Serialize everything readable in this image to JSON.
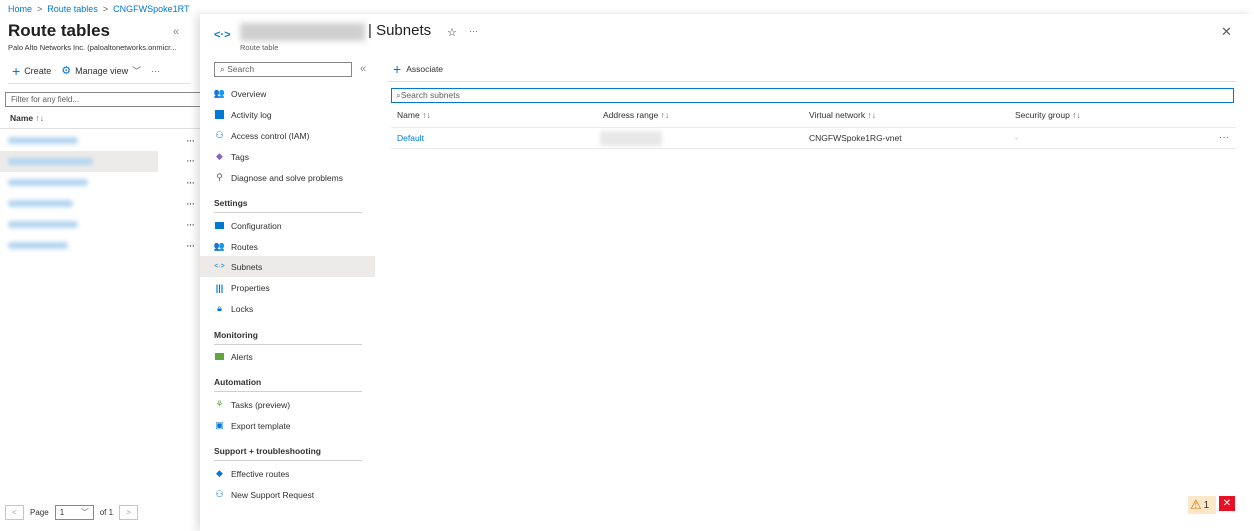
{
  "breadcrumb": [
    "Home",
    "Route tables",
    "CNGFWSpoke1RT"
  ],
  "left": {
    "title": "Route tables",
    "subtitle": "Palo Alto Networks Inc. (paloaltonetworks.onmicr...",
    "create_label": "Create",
    "manage_view_label": "Manage view",
    "filter_placeholder": "Filter for any field...",
    "name_header": "Name",
    "row_count": 6,
    "pager": {
      "page_label": "Page",
      "page_value": "1",
      "of_label": "of 1"
    }
  },
  "blade": {
    "title_suffix": "| Subnets",
    "subtitle": "Route table",
    "search_placeholder": "Search",
    "menu": [
      {
        "label": "Overview",
        "icon": "overview-icon"
      },
      {
        "label": "Activity log",
        "icon": "activity-log-icon"
      },
      {
        "label": "Access control (IAM)",
        "icon": "iam-icon"
      },
      {
        "label": "Tags",
        "icon": "tag-icon"
      },
      {
        "label": "Diagnose and solve problems",
        "icon": "wrench-icon"
      }
    ],
    "sections": {
      "settings": "Settings",
      "monitoring": "Monitoring",
      "automation": "Automation",
      "support": "Support + troubleshooting"
    },
    "settings_items": [
      "Configuration",
      "Routes",
      "Subnets",
      "Properties",
      "Locks"
    ],
    "monitoring_items": [
      "Alerts"
    ],
    "automation_items": [
      "Tasks (preview)",
      "Export template"
    ],
    "support_items": [
      "Effective routes",
      "New Support Request"
    ]
  },
  "content": {
    "associate_label": "Associate",
    "search_placeholder": "Search subnets",
    "columns": [
      "Name",
      "Address range",
      "Virtual network",
      "Security group"
    ],
    "rows": [
      {
        "name": "Default",
        "virtual_network": "CNGFWSpoke1RG-vnet",
        "security_group": "-"
      }
    ]
  },
  "notifications": {
    "warning_count": "1"
  }
}
